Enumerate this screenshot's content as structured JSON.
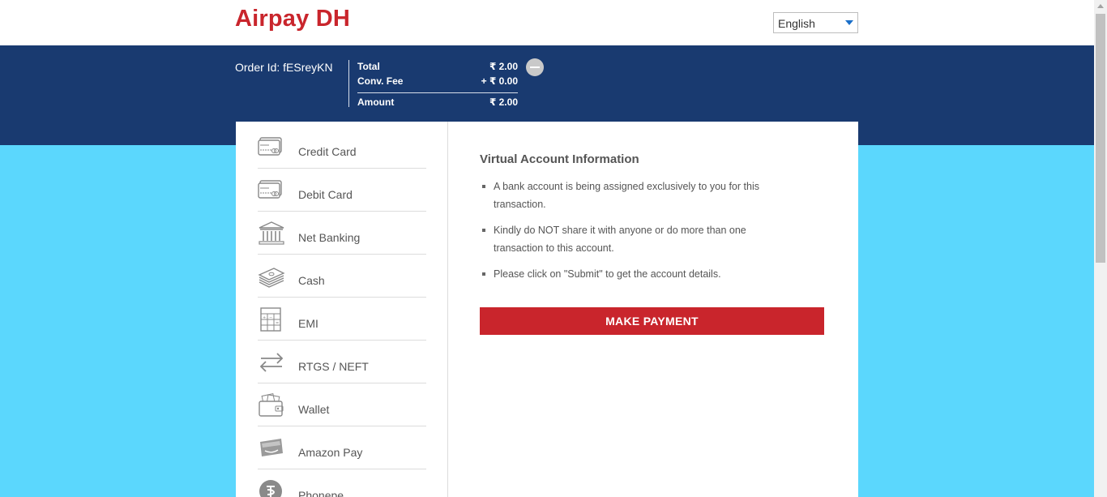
{
  "header": {
    "brand": "Airpay DH",
    "language": "English"
  },
  "order": {
    "id_label": "Order Id: fESreyKN",
    "total_label": "Total",
    "total_value": "₹ 2.00",
    "fee_label": "Conv. Fee",
    "fee_value": "+ ₹ 0.00",
    "amount_label": "Amount",
    "amount_value": "₹ 2.00"
  },
  "sidebar": {
    "items": [
      {
        "label": "Credit Card",
        "icon": "credit-card-icon"
      },
      {
        "label": "Debit Card",
        "icon": "debit-card-icon"
      },
      {
        "label": "Net Banking",
        "icon": "bank-icon"
      },
      {
        "label": "Cash",
        "icon": "cash-icon"
      },
      {
        "label": "EMI",
        "icon": "calculator-icon"
      },
      {
        "label": "RTGS / NEFT",
        "icon": "transfer-arrows-icon"
      },
      {
        "label": "Wallet",
        "icon": "wallet-icon"
      },
      {
        "label": "Amazon Pay",
        "icon": "amazon-pay-icon"
      },
      {
        "label": "Phonepe",
        "icon": "phonepe-icon"
      }
    ]
  },
  "content": {
    "title": "Virtual Account Information",
    "points": [
      "A bank account is being assigned exclusively to you for this transaction.",
      "Kindly do NOT share it with anyone or do more than one transaction to this account.",
      "Please click on \"Submit\" to get the account details."
    ],
    "button": "MAKE PAYMENT"
  },
  "colors": {
    "brand_red": "#c9252c",
    "nav_blue": "#193a70",
    "background_cyan": "#5bd7fd"
  }
}
